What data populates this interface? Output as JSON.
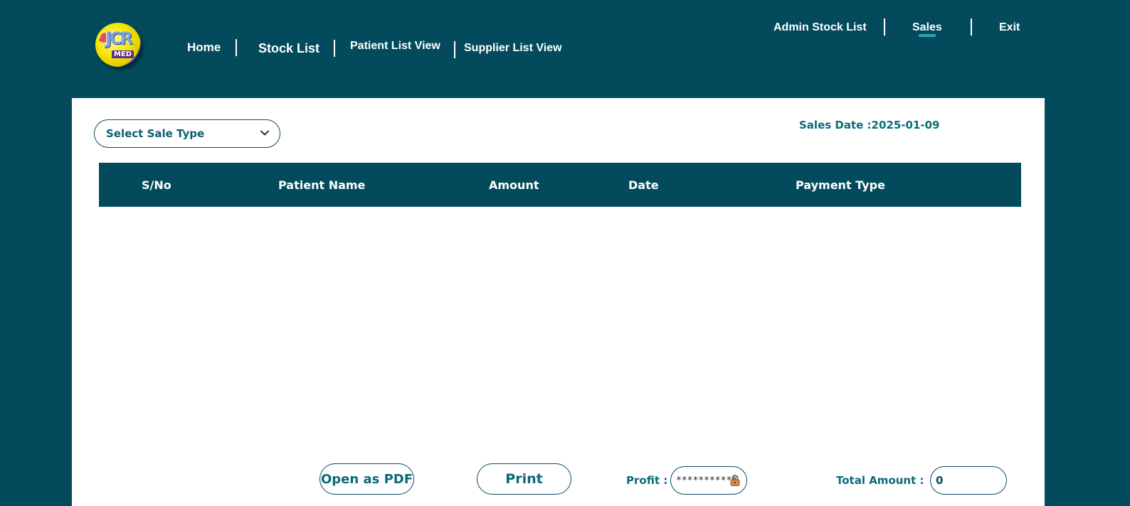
{
  "header": {
    "logo_text": "JCR",
    "logo_sub": "MED",
    "nav_left": [
      "Home",
      "Stock List",
      "Patient List View",
      "Supplier List View"
    ],
    "nav_right": [
      "Admin Stock List",
      "Sales",
      "Exit"
    ],
    "active_item": "Sales"
  },
  "filters": {
    "sale_type_selected": "Select Sale Type",
    "sales_date_label": "Sales Date :",
    "sales_date_value": "2025-01-09"
  },
  "table": {
    "columns": [
      "S/No",
      "Patient Name",
      "Amount",
      "Date",
      "Payment Type"
    ],
    "rows": []
  },
  "footer": {
    "open_pdf_label": "Open as PDF",
    "print_label": "Print",
    "profit_label": "Profit :",
    "profit_value": "***********",
    "total_label": "Total Amount :",
    "total_value": "0"
  },
  "colors": {
    "background": "#034b5c",
    "panel": "#ffffff",
    "accent_text": "#0b6a78",
    "active_underline": "#2aa7b6"
  },
  "icons": [
    "app-logo",
    "chevron-down-icon",
    "lock-icon"
  ]
}
